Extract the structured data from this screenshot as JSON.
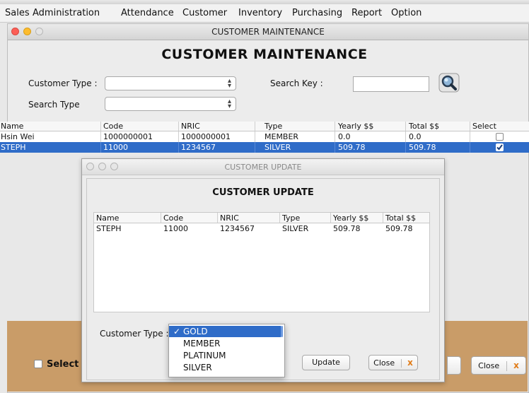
{
  "menubar": {
    "items": [
      "Sales",
      "Administration",
      "Attendance",
      "Customer",
      "Inventory",
      "Purchasing",
      "Report",
      "Option"
    ]
  },
  "main_window": {
    "title": "CUSTOMER MAINTENANCE",
    "heading": "CUSTOMER MAINTENANCE",
    "customer_type_label": "Customer Type :",
    "customer_type_value": "",
    "search_type_label": "Search Type",
    "search_type_value": "",
    "search_key_label": "Search Key :",
    "search_key_value": "",
    "search_icon": "magnifier-icon",
    "table": {
      "columns": [
        "Name",
        "Code",
        "NRIC",
        "Type",
        "Yearly $$",
        "Total $$",
        "Select"
      ],
      "rows": [
        {
          "name": "Hsin Wei",
          "code": "1000000001",
          "nric": "1000000001",
          "type": "MEMBER",
          "yearly": "0.0",
          "total": "0.0",
          "selected": false
        },
        {
          "name": "STEPH",
          "code": "11000",
          "nric": "1234567",
          "type": "SILVER",
          "yearly": "509.78",
          "total": "509.78",
          "selected": true
        }
      ]
    },
    "select_all_label": "Select",
    "close_label": "Close",
    "close_icon_glyph": "x"
  },
  "dialog": {
    "title": "CUSTOMER UPDATE",
    "heading": "CUSTOMER UPDATE",
    "table": {
      "columns": [
        "Name",
        "Code",
        "NRIC",
        "Type",
        "Yearly $$",
        "Total $$"
      ],
      "rows": [
        {
          "name": "STEPH",
          "code": "11000",
          "nric": "1234567",
          "type": "SILVER",
          "yearly": "509.78",
          "total": "509.78"
        }
      ]
    },
    "customer_type_label": "Customer Type :",
    "update_label": "Update",
    "close_label": "Close",
    "close_icon_glyph": "x",
    "dropdown": {
      "check_glyph": "✓",
      "options": [
        "GOLD",
        "MEMBER",
        "PLATINUM",
        "SILVER"
      ],
      "selected": "GOLD"
    }
  },
  "colors": {
    "selection": "#2f6cc8",
    "brown_panel": "#c99c68",
    "close_x": "#e07b17"
  }
}
